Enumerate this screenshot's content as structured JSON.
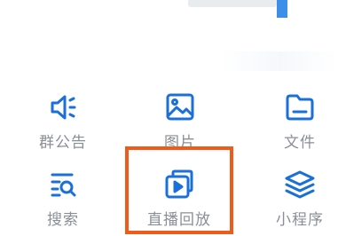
{
  "theme": {
    "icon_color": "#1a6fd8",
    "label_color": "#8a8f97",
    "highlight_color": "#f05a1a"
  },
  "tools": [
    {
      "label": "群公告",
      "icon": "speaker-icon"
    },
    {
      "label": "图片",
      "icon": "image-icon"
    },
    {
      "label": "文件",
      "icon": "folder-icon"
    },
    {
      "label": "搜索",
      "icon": "search-list-icon"
    },
    {
      "label": "直播回放",
      "icon": "live-replay-icon"
    },
    {
      "label": "小程序",
      "icon": "layers-icon"
    }
  ]
}
